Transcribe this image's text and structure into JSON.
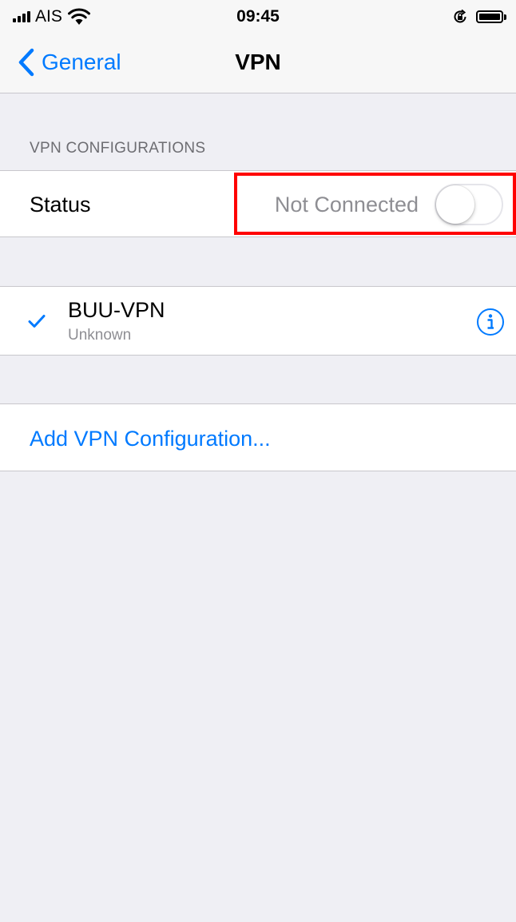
{
  "status_bar": {
    "carrier": "AIS",
    "time": "09:45"
  },
  "nav": {
    "back_label": "General",
    "title": "VPN"
  },
  "section_header": "VPN CONFIGURATIONS",
  "status_row": {
    "label": "Status",
    "value": "Not Connected",
    "toggle_on": false
  },
  "vpn_configurations": [
    {
      "name": "BUU-VPN",
      "subtitle": "Unknown",
      "selected": true
    }
  ],
  "add_configuration_label": "Add VPN Configuration...",
  "colors": {
    "accent": "#007aff",
    "highlight": "#ff0000",
    "background": "#efeff4",
    "secondary_text": "#8e8e93"
  },
  "icons": [
    "signal-icon",
    "wifi-icon",
    "rotation-lock-icon",
    "battery-icon",
    "chevron-left-icon",
    "checkmark-icon",
    "info-icon"
  ]
}
